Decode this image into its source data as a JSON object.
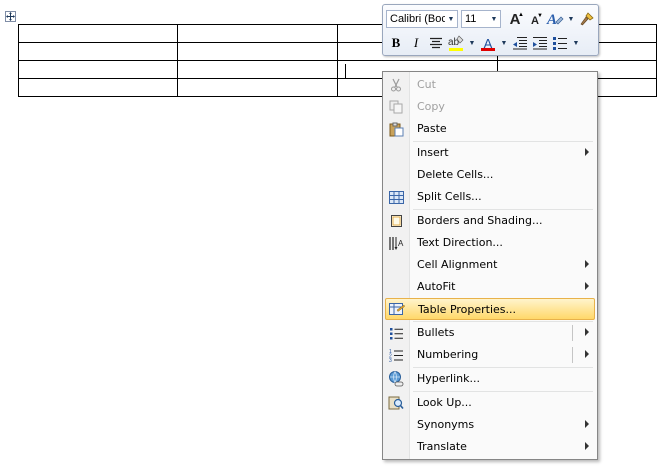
{
  "mini_toolbar": {
    "font_name": "Calibri (Boc",
    "font_size": "11",
    "highlight_color": "#ffff00",
    "font_color": "#e00000",
    "icons": [
      "grow-font-icon",
      "shrink-font-icon",
      "styles-icon",
      "format-painter-icon",
      "bold-icon",
      "italic-icon",
      "center-icon",
      "highlight-icon",
      "font-color-icon",
      "decrease-indent-icon",
      "increase-indent-icon",
      "bullets-icon"
    ]
  },
  "table": {
    "rows": 4,
    "cols": 4
  },
  "context_menu": {
    "items": [
      {
        "label": "Cut",
        "icon": "scissors-icon",
        "enabled": false
      },
      {
        "label": "Copy",
        "icon": "copy-icon",
        "enabled": false
      },
      {
        "label": "Paste",
        "icon": "paste-icon",
        "enabled": true
      },
      {
        "label": "Insert",
        "icon": "",
        "enabled": true,
        "submenu": true
      },
      {
        "label": "Delete Cells...",
        "icon": "",
        "enabled": true
      },
      {
        "label": "Split Cells...",
        "icon": "split-cells-icon",
        "enabled": true
      },
      {
        "label": "Borders and Shading...",
        "icon": "borders-icon",
        "enabled": true
      },
      {
        "label": "Text Direction...",
        "icon": "text-direction-icon",
        "enabled": true
      },
      {
        "label": "Cell Alignment",
        "icon": "",
        "enabled": true,
        "submenu": true
      },
      {
        "label": "AutoFit",
        "icon": "",
        "enabled": true,
        "submenu": true
      },
      {
        "label": "Table Properties...",
        "icon": "table-properties-icon",
        "enabled": true,
        "highlighted": true
      },
      {
        "label": "Bullets",
        "icon": "bullets-icon",
        "enabled": true,
        "submenu": true
      },
      {
        "label": "Numbering",
        "icon": "numbering-icon",
        "enabled": true,
        "submenu": true
      },
      {
        "label": "Hyperlink...",
        "icon": "hyperlink-icon",
        "enabled": true
      },
      {
        "label": "Look Up...",
        "icon": "look-up-icon",
        "enabled": true
      },
      {
        "label": "Synonyms",
        "icon": "",
        "enabled": true,
        "submenu": true
      },
      {
        "label": "Translate",
        "icon": "",
        "enabled": true,
        "submenu": true
      }
    ]
  }
}
